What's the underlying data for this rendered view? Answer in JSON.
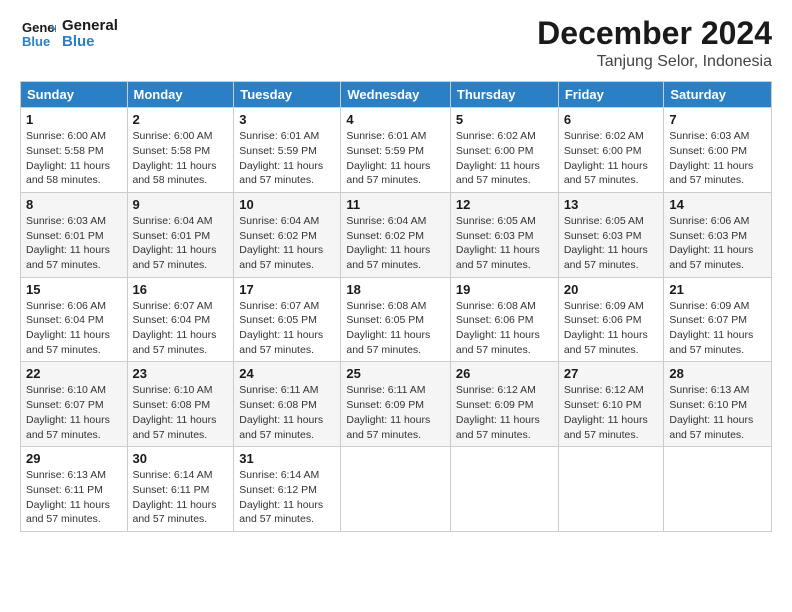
{
  "logo": {
    "line1": "General",
    "line2": "Blue"
  },
  "title": "December 2024",
  "subtitle": "Tanjung Selor, Indonesia",
  "days_of_week": [
    "Sunday",
    "Monday",
    "Tuesday",
    "Wednesday",
    "Thursday",
    "Friday",
    "Saturday"
  ],
  "weeks": [
    [
      {
        "day": "1",
        "sunrise": "6:00 AM",
        "sunset": "5:58 PM",
        "daylight": "11 hours and 58 minutes."
      },
      {
        "day": "2",
        "sunrise": "6:00 AM",
        "sunset": "5:58 PM",
        "daylight": "11 hours and 58 minutes."
      },
      {
        "day": "3",
        "sunrise": "6:01 AM",
        "sunset": "5:59 PM",
        "daylight": "11 hours and 57 minutes."
      },
      {
        "day": "4",
        "sunrise": "6:01 AM",
        "sunset": "5:59 PM",
        "daylight": "11 hours and 57 minutes."
      },
      {
        "day": "5",
        "sunrise": "6:02 AM",
        "sunset": "6:00 PM",
        "daylight": "11 hours and 57 minutes."
      },
      {
        "day": "6",
        "sunrise": "6:02 AM",
        "sunset": "6:00 PM",
        "daylight": "11 hours and 57 minutes."
      },
      {
        "day": "7",
        "sunrise": "6:03 AM",
        "sunset": "6:00 PM",
        "daylight": "11 hours and 57 minutes."
      }
    ],
    [
      {
        "day": "8",
        "sunrise": "6:03 AM",
        "sunset": "6:01 PM",
        "daylight": "11 hours and 57 minutes."
      },
      {
        "day": "9",
        "sunrise": "6:04 AM",
        "sunset": "6:01 PM",
        "daylight": "11 hours and 57 minutes."
      },
      {
        "day": "10",
        "sunrise": "6:04 AM",
        "sunset": "6:02 PM",
        "daylight": "11 hours and 57 minutes."
      },
      {
        "day": "11",
        "sunrise": "6:04 AM",
        "sunset": "6:02 PM",
        "daylight": "11 hours and 57 minutes."
      },
      {
        "day": "12",
        "sunrise": "6:05 AM",
        "sunset": "6:03 PM",
        "daylight": "11 hours and 57 minutes."
      },
      {
        "day": "13",
        "sunrise": "6:05 AM",
        "sunset": "6:03 PM",
        "daylight": "11 hours and 57 minutes."
      },
      {
        "day": "14",
        "sunrise": "6:06 AM",
        "sunset": "6:03 PM",
        "daylight": "11 hours and 57 minutes."
      }
    ],
    [
      {
        "day": "15",
        "sunrise": "6:06 AM",
        "sunset": "6:04 PM",
        "daylight": "11 hours and 57 minutes."
      },
      {
        "day": "16",
        "sunrise": "6:07 AM",
        "sunset": "6:04 PM",
        "daylight": "11 hours and 57 minutes."
      },
      {
        "day": "17",
        "sunrise": "6:07 AM",
        "sunset": "6:05 PM",
        "daylight": "11 hours and 57 minutes."
      },
      {
        "day": "18",
        "sunrise": "6:08 AM",
        "sunset": "6:05 PM",
        "daylight": "11 hours and 57 minutes."
      },
      {
        "day": "19",
        "sunrise": "6:08 AM",
        "sunset": "6:06 PM",
        "daylight": "11 hours and 57 minutes."
      },
      {
        "day": "20",
        "sunrise": "6:09 AM",
        "sunset": "6:06 PM",
        "daylight": "11 hours and 57 minutes."
      },
      {
        "day": "21",
        "sunrise": "6:09 AM",
        "sunset": "6:07 PM",
        "daylight": "11 hours and 57 minutes."
      }
    ],
    [
      {
        "day": "22",
        "sunrise": "6:10 AM",
        "sunset": "6:07 PM",
        "daylight": "11 hours and 57 minutes."
      },
      {
        "day": "23",
        "sunrise": "6:10 AM",
        "sunset": "6:08 PM",
        "daylight": "11 hours and 57 minutes."
      },
      {
        "day": "24",
        "sunrise": "6:11 AM",
        "sunset": "6:08 PM",
        "daylight": "11 hours and 57 minutes."
      },
      {
        "day": "25",
        "sunrise": "6:11 AM",
        "sunset": "6:09 PM",
        "daylight": "11 hours and 57 minutes."
      },
      {
        "day": "26",
        "sunrise": "6:12 AM",
        "sunset": "6:09 PM",
        "daylight": "11 hours and 57 minutes."
      },
      {
        "day": "27",
        "sunrise": "6:12 AM",
        "sunset": "6:10 PM",
        "daylight": "11 hours and 57 minutes."
      },
      {
        "day": "28",
        "sunrise": "6:13 AM",
        "sunset": "6:10 PM",
        "daylight": "11 hours and 57 minutes."
      }
    ],
    [
      {
        "day": "29",
        "sunrise": "6:13 AM",
        "sunset": "6:11 PM",
        "daylight": "11 hours and 57 minutes."
      },
      {
        "day": "30",
        "sunrise": "6:14 AM",
        "sunset": "6:11 PM",
        "daylight": "11 hours and 57 minutes."
      },
      {
        "day": "31",
        "sunrise": "6:14 AM",
        "sunset": "6:12 PM",
        "daylight": "11 hours and 57 minutes."
      },
      null,
      null,
      null,
      null
    ]
  ],
  "labels": {
    "sunrise": "Sunrise:",
    "sunset": "Sunset:",
    "daylight": "Daylight:"
  }
}
